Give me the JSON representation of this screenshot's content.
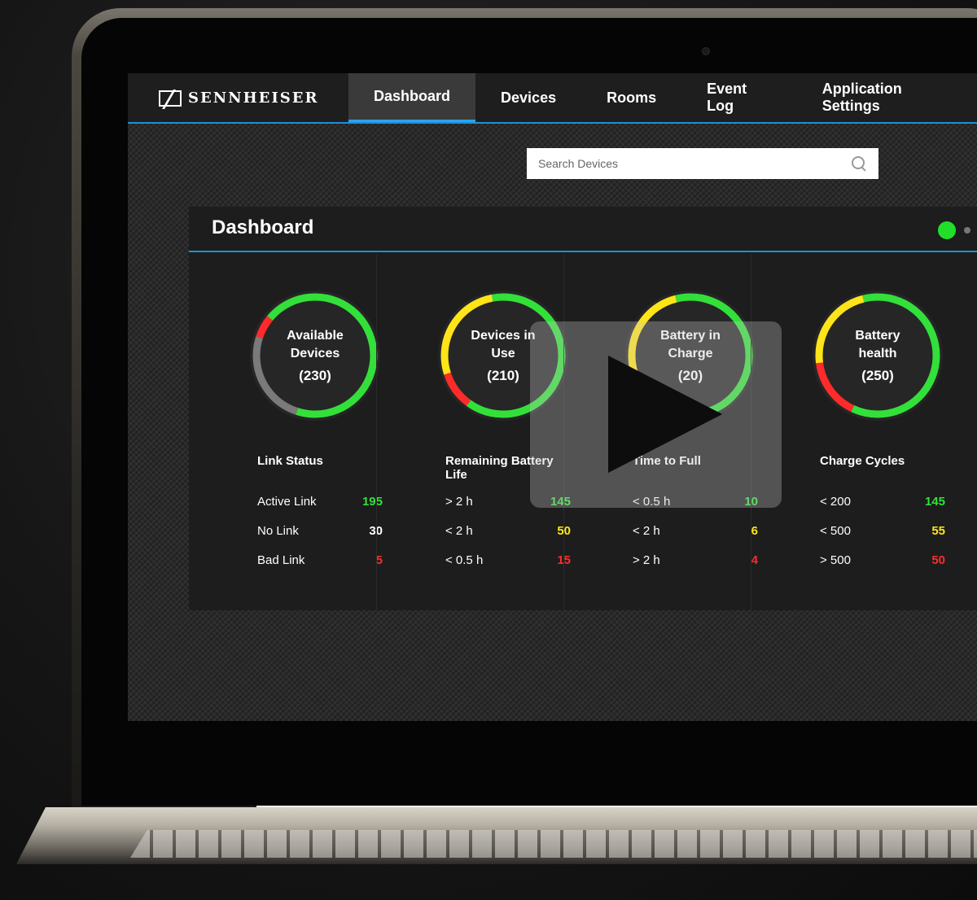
{
  "brand": {
    "name": "SENNHEISER"
  },
  "nav": {
    "items": [
      {
        "label": "Dashboard",
        "active": true
      },
      {
        "label": "Devices",
        "active": false
      },
      {
        "label": "Rooms",
        "active": false
      },
      {
        "label": "Event Log",
        "active": false
      },
      {
        "label": "Application Settings",
        "active": false
      }
    ]
  },
  "search": {
    "placeholder": "Search Devices",
    "icon": "search-icon"
  },
  "panel": {
    "title": "Dashboard"
  },
  "colors": {
    "green": "#33e03a",
    "yellow": "#ffe417",
    "red": "#ff2b2b",
    "gray": "#7a7a7a",
    "accent": "#1e8fd6"
  },
  "columns": [
    {
      "gauge_title": "Available Devices",
      "gauge_count": "(230)",
      "section_title": "Link Status",
      "segments": [
        {
          "color": "green",
          "fraction": 0.55
        },
        {
          "color": "gray",
          "fraction": 0.25
        },
        {
          "color": "red",
          "fraction": 0.06
        },
        {
          "color": "green",
          "fraction": 0.14
        }
      ],
      "rows": [
        {
          "label": "Active Link",
          "value": "195",
          "color": "green"
        },
        {
          "label": "No Link",
          "value": "30",
          "color": "white"
        },
        {
          "label": "Bad Link",
          "value": "5",
          "color": "red"
        }
      ]
    },
    {
      "gauge_title": "Devices in Use",
      "gauge_count": "(210)",
      "section_title": "Remaining Battery Life",
      "segments": [
        {
          "color": "green",
          "fraction": 0.6
        },
        {
          "color": "red",
          "fraction": 0.1
        },
        {
          "color": "yellow",
          "fraction": 0.27
        },
        {
          "color": "green",
          "fraction": 0.03
        }
      ],
      "rows": [
        {
          "label": "> 2 h",
          "value": "145",
          "color": "green"
        },
        {
          "label": "< 2 h",
          "value": "50",
          "color": "yellow"
        },
        {
          "label": "< 0.5 h",
          "value": "15",
          "color": "red"
        }
      ]
    },
    {
      "gauge_title": "Battery in Charge",
      "gauge_count": "(20)",
      "section_title": "Time to Full",
      "segments": [
        {
          "color": "green",
          "fraction": 0.5
        },
        {
          "color": "red",
          "fraction": 0.18
        },
        {
          "color": "yellow",
          "fraction": 0.28
        },
        {
          "color": "green",
          "fraction": 0.04
        }
      ],
      "rows": [
        {
          "label": "< 0.5 h",
          "value": "10",
          "color": "green"
        },
        {
          "label": "< 2 h",
          "value": "6",
          "color": "yellow"
        },
        {
          "label": "> 2 h",
          "value": "4",
          "color": "red"
        }
      ]
    },
    {
      "gauge_title": "Battery health",
      "gauge_count": "(250)",
      "section_title": "Charge Cycles",
      "segments": [
        {
          "color": "green",
          "fraction": 0.57
        },
        {
          "color": "red",
          "fraction": 0.16
        },
        {
          "color": "yellow",
          "fraction": 0.23
        },
        {
          "color": "green",
          "fraction": 0.04
        }
      ],
      "rows": [
        {
          "label": "< 200",
          "value": "145",
          "color": "green"
        },
        {
          "label": "< 500",
          "value": "55",
          "color": "yellow"
        },
        {
          "label": "> 500",
          "value": "50",
          "color": "red"
        }
      ]
    }
  ],
  "video": {
    "icon": "play-icon"
  }
}
